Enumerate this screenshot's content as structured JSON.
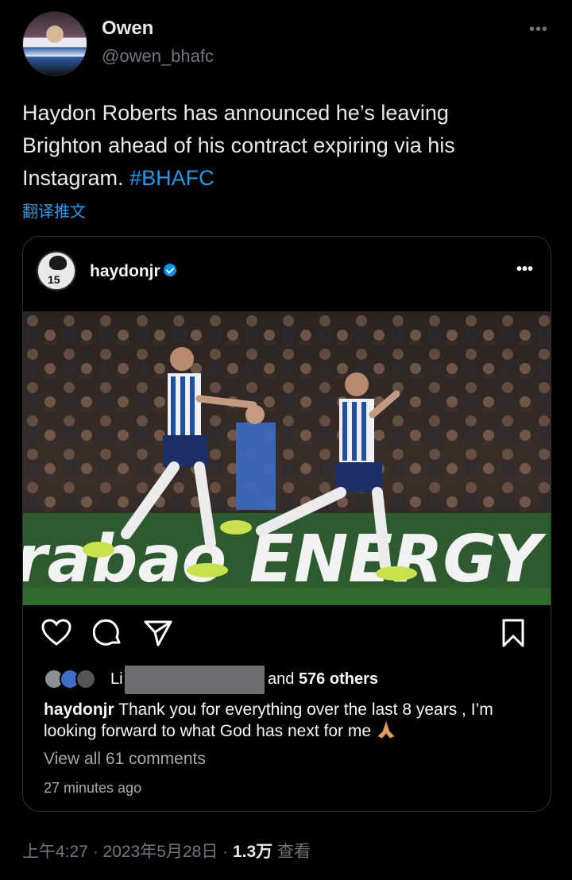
{
  "author": {
    "name": "Owen",
    "handle": "@owen_bhafc",
    "more_label": "•••"
  },
  "tweet": {
    "text": "Haydon Roberts has announced he’s leaving Brighton ahead of his contract expiring via his Instagram. ",
    "hashtag": "#BHAFC",
    "translate_label": "翻译推文"
  },
  "instagram": {
    "username": "haydonjr",
    "avatar_number": "15",
    "more_label": "•••",
    "photo_signage": "rabao ENERGY",
    "likes": {
      "liker_prefix": "Li",
      "others_text_pre": "and ",
      "others_count": "576 others"
    },
    "caption": {
      "user": "haydonjr",
      "text": " Thank you for everything over the last 8 years , I’m looking forward to what God has next for me"
    },
    "view_comments": "View all 61 comments",
    "time_ago": "27 minutes ago"
  },
  "meta": {
    "time": "上午4:27",
    "separator": " · ",
    "date": "2023年5月28日",
    "views_count": "1.3万",
    "views_label": " 查看"
  },
  "colors": {
    "background": "#000000",
    "link": "#1d9bf0",
    "muted": "#71767b",
    "verified": "#0095f6"
  }
}
